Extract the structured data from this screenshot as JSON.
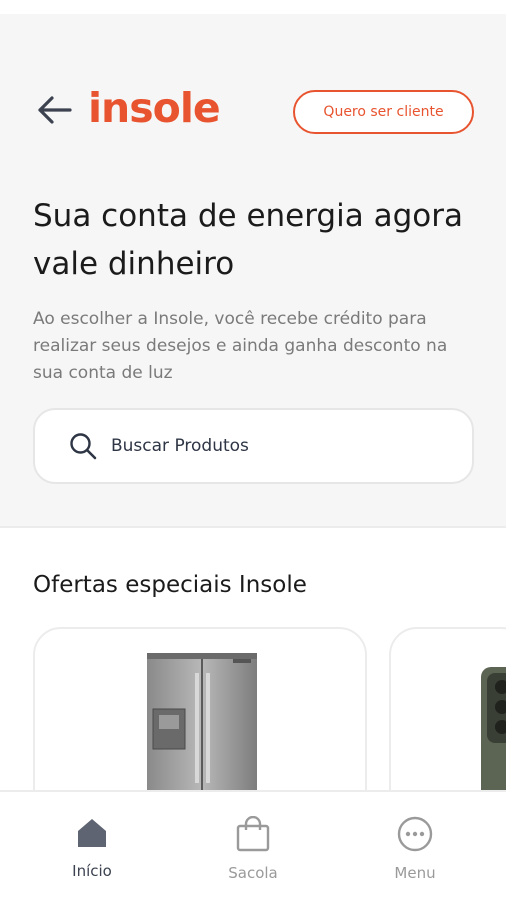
{
  "header": {
    "back_icon": "arrow-left-icon",
    "logo_text": "insole",
    "cta_label": "Quero ser cliente"
  },
  "hero": {
    "headline": "Sua conta de energia agora vale dinheiro",
    "subtext": "Ao escolher a Insole, você recebe crédito para realizar seus desejos e ainda ganha desconto na sua conta de luz"
  },
  "search": {
    "icon": "search-icon",
    "placeholder": "Buscar Produtos"
  },
  "offers": {
    "title": "Ofertas especiais Insole",
    "products": [
      {
        "image": "refrigerator-image"
      },
      {
        "image": "smartphone-image"
      }
    ]
  },
  "bottom_nav": {
    "items": [
      {
        "label": "Início",
        "icon": "home-icon",
        "active": true
      },
      {
        "label": "Sacola",
        "icon": "bag-icon",
        "active": false
      },
      {
        "label": "Menu",
        "icon": "more-icon",
        "active": false
      }
    ]
  },
  "colors": {
    "brand": "#e8542f",
    "hero_bg": "#f6f6f6",
    "text_dark": "#1b1b1b",
    "text_muted": "#7a7a7a"
  }
}
